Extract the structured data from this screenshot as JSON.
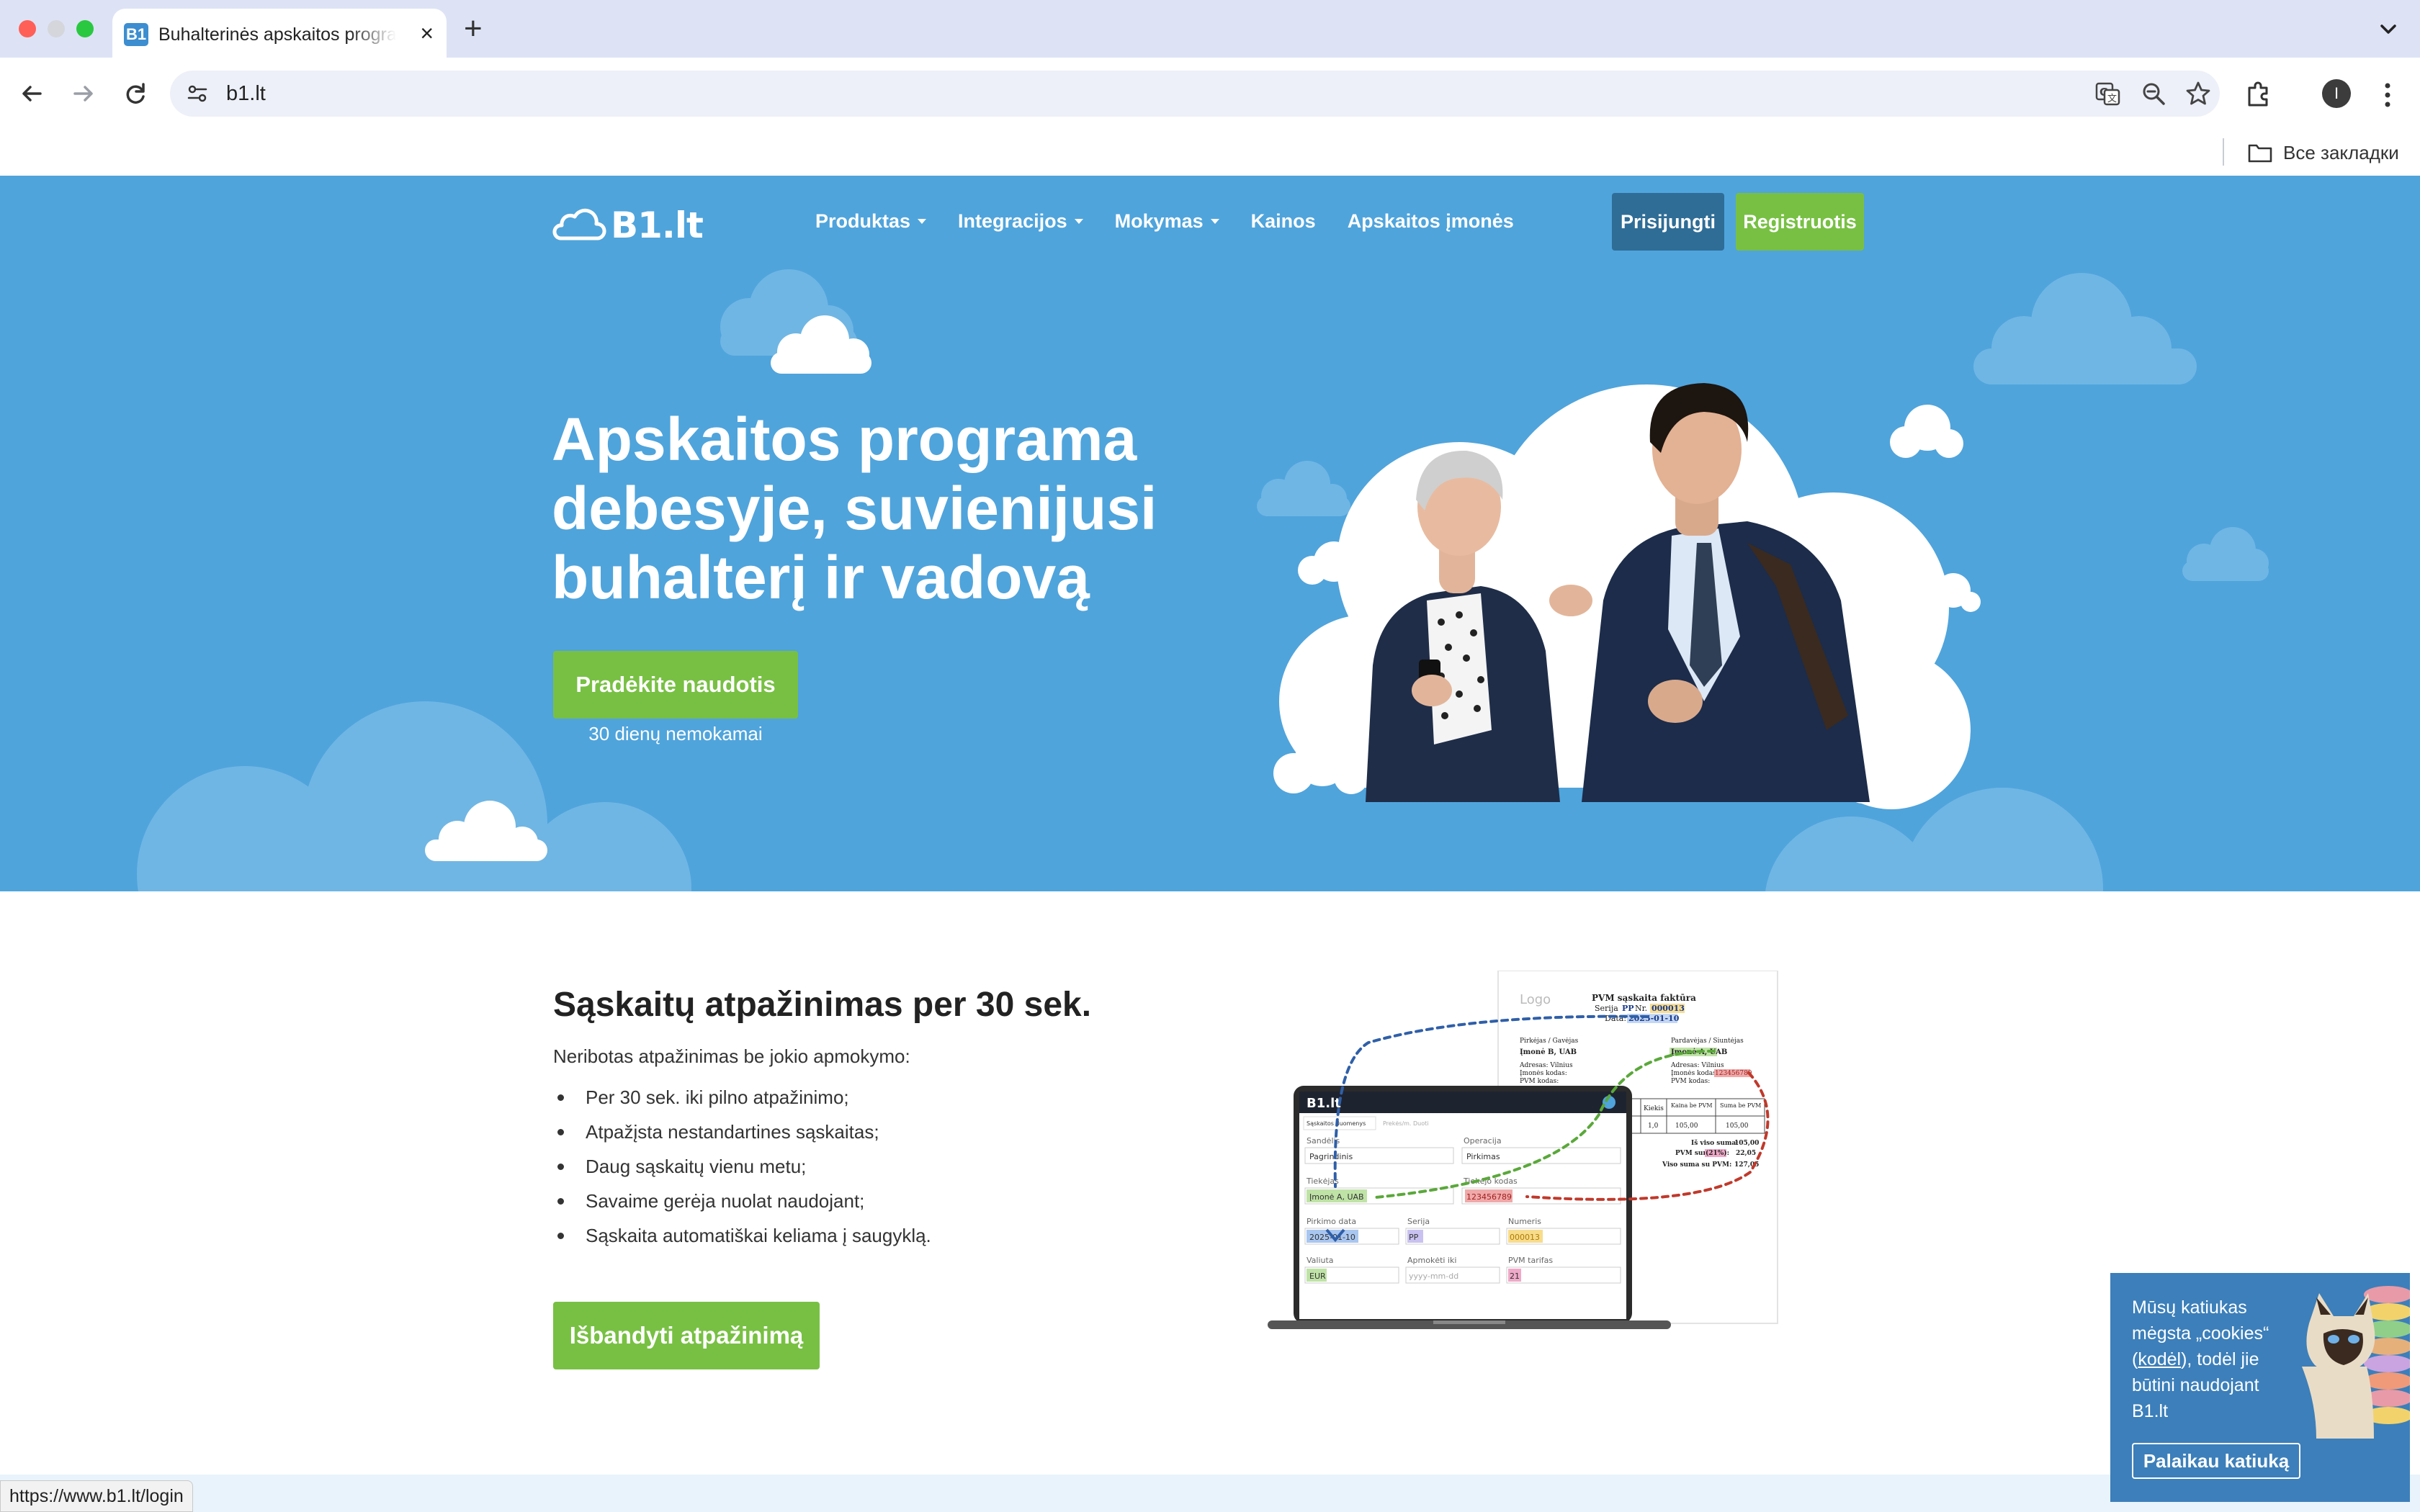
{
  "browser": {
    "tab_title": "Buhalterinės apskaitos programa",
    "favicon_text": "B1",
    "url": "b1.lt",
    "bookmarks_folder": "Все закладки",
    "profile_initial": "I",
    "status_url": "https://www.b1.lt/login"
  },
  "header": {
    "logo": "B1.lt",
    "nav": [
      {
        "label": "Produktas",
        "dropdown": true
      },
      {
        "label": "Integracijos",
        "dropdown": true
      },
      {
        "label": "Mokymas",
        "dropdown": true
      },
      {
        "label": "Kainos",
        "dropdown": false
      },
      {
        "label": "Apskaitos įmonės",
        "dropdown": false
      }
    ],
    "login_label": "Prisijungti",
    "register_label": "Registruotis"
  },
  "hero": {
    "title_lines": [
      "Apskaitos programa",
      "debesyje, suvienijusi",
      "buhalterį ir vadovą"
    ],
    "cta_label": "Pradėkite naudotis",
    "trial_note": "30 dienų nemokamai"
  },
  "recognition": {
    "title": "Sąskaitų atpažinimas per 30 sek.",
    "intro": "Neribotas atpažinimas be jokio apmokymo:",
    "bullets": [
      "Per 30 sek. iki pilno atpažinimo;",
      "Atpažįsta nestandartines sąskaitas;",
      "Daug sąskaitų vienu metu;",
      "Savaime gerėja nuolat naudojant;",
      "Sąskaita automatiškai keliama į saugyklą."
    ],
    "cta_label": "Išbandyti atpažinimą",
    "invoice": {
      "logo": "Logo",
      "heading": "PVM sąskaita faktūra",
      "serial_prefix": "Serija",
      "serial": "PP",
      "number_prefix": "Nr.",
      "number": "000013",
      "date_label": "Data:",
      "date": "2025-01-10",
      "buyer_heading": "Pirkėjas / Gavėjas",
      "seller_heading": "Pardavėjas / Siuntėjas",
      "buyer_name": "Įmonė B, UAB",
      "seller_name": "Įmonė A, UAB",
      "address": "Adresas: Vilnius",
      "code_label": "Įmonės kodas:",
      "seller_code": "123456789",
      "vat_label": "PVM kodas:",
      "col_qty": "Kiekis",
      "col_price": "Kaina be PVM",
      "col_sum": "Suma be PVM",
      "row_qty": "1,0",
      "row_price": "105,00",
      "row_sum": "105,00",
      "total_label": "Iš viso suma:",
      "total": "105,00",
      "vat_sum_label": "PVM suma",
      "vat_rate": "(21%):",
      "vat_sum": "22,05",
      "grand_label": "Viso suma su PVM:",
      "grand_total": "127,05"
    },
    "app_form": {
      "logo": "B1.lt",
      "tabs": [
        "Sąskaitos duomenys",
        "Prekės/m. Duoti"
      ],
      "fields": [
        {
          "label": "Sandėlis",
          "value": "Pagrindinis"
        },
        {
          "label": "Operacija",
          "value": "Pirkimas"
        },
        {
          "label": "Tiekėjas",
          "value": "Įmonė A, UAB"
        },
        {
          "label": "Tiekėjo kodas",
          "value": "123456789"
        },
        {
          "label": "Pirkimo data",
          "value": "2025-01-10"
        },
        {
          "label": "Serija",
          "value": "PP"
        },
        {
          "label": "Numeris",
          "value": "000013"
        },
        {
          "label": "Valiuta",
          "value": "EUR"
        },
        {
          "label": "Apmokėti iki",
          "value": "yyyy-mm-dd"
        },
        {
          "label": "PVM tarifas",
          "value": "21"
        }
      ]
    }
  },
  "cookie": {
    "text_before": "Mūsų katiukas mėgsta „cookies“ (",
    "link_label": "kodėl",
    "text_after": "), todėl jie būtini naudojant B1.lt",
    "button_label": "Palaikau katiuką"
  },
  "colors": {
    "hero_bg": "#4fa4dc",
    "green": "#78c043",
    "login_blue": "#2f6d96",
    "cookie_bg": "#3c7fba"
  }
}
